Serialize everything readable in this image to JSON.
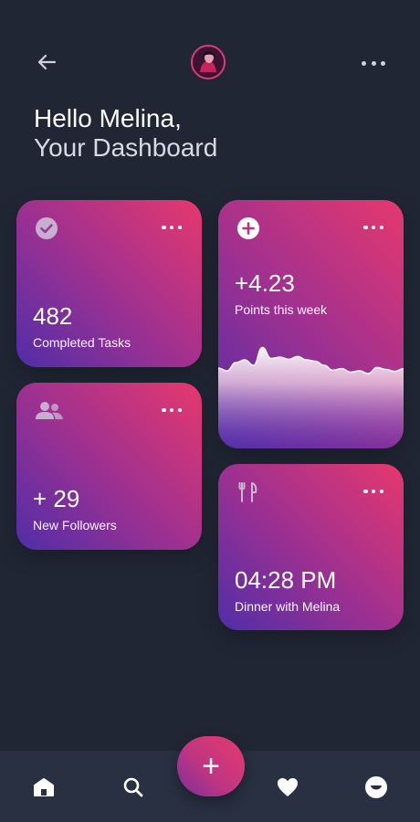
{
  "header": {
    "back_icon": "arrow-left-icon",
    "avatar_icon": "user-avatar",
    "menu_icon": "more-horizontal-icon"
  },
  "greeting": {
    "line1": "Hello Melina,",
    "line2": "Your Dashboard"
  },
  "cards": {
    "tasks": {
      "icon": "check-circle-icon",
      "value": "482",
      "label": "Completed Tasks"
    },
    "points": {
      "icon": "plus-circle-icon",
      "value": "+4.23",
      "label": "Points this week",
      "chart_data": {
        "type": "area",
        "values": [
          0.2,
          0.1,
          0.4,
          0.5,
          0.3,
          0.95,
          0.55,
          0.6,
          0.52,
          0.62,
          0.5,
          0.45,
          0.3,
          0.12,
          0.18,
          0.05,
          0.1,
          0.0,
          0.22,
          0.15,
          0.08,
          0.18
        ]
      }
    },
    "followers": {
      "icon": "users-icon",
      "value": "+ 29",
      "label": "New Followers"
    },
    "dinner": {
      "icon": "cutlery-icon",
      "value": "04:28 PM",
      "label": "Dinner with Melina"
    }
  },
  "bottom_nav": {
    "items": [
      "home-icon",
      "search-icon",
      "add-icon",
      "heart-icon",
      "smile-icon"
    ]
  },
  "colors": {
    "background": "#202634",
    "bottom_bar": "#283041",
    "card_gradient_start": "#4f2ea8",
    "card_gradient_end": "#e6386e"
  }
}
